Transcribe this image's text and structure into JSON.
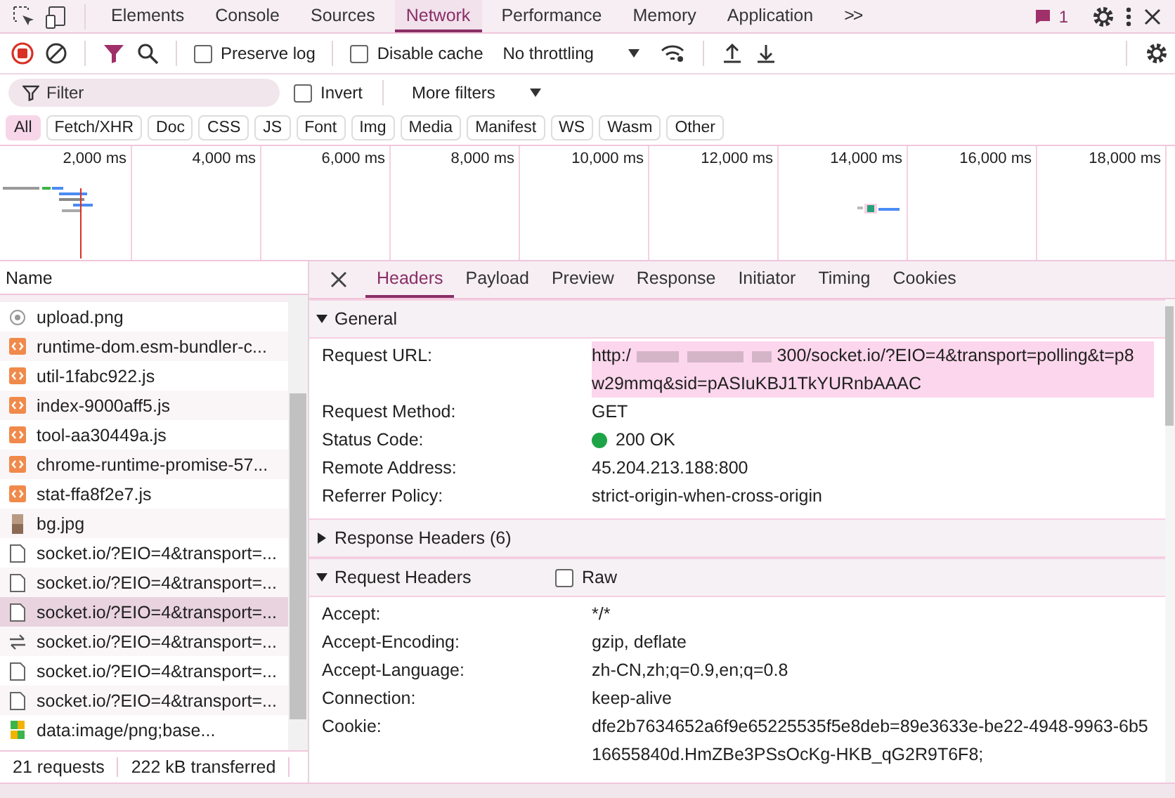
{
  "tabs": [
    {
      "label": "Elements",
      "selected": false
    },
    {
      "label": "Console",
      "selected": false
    },
    {
      "label": "Sources",
      "selected": false
    },
    {
      "label": "Network",
      "selected": true
    },
    {
      "label": "Performance",
      "selected": false
    },
    {
      "label": "Memory",
      "selected": false
    },
    {
      "label": "Application",
      "selected": false
    }
  ],
  "more_tabs": ">>",
  "issues_count": "1",
  "toolbar": {
    "preserve_log": {
      "label": "Preserve log",
      "checked": false
    },
    "disable_cache": {
      "label": "Disable cache",
      "checked": false
    },
    "throttling": "No throttling"
  },
  "filter": {
    "placeholder": "Filter",
    "invert": {
      "label": "Invert",
      "checked": false
    },
    "more_filters": "More filters"
  },
  "type_filters": [
    {
      "label": "All",
      "selected": true
    },
    {
      "label": "Fetch/XHR",
      "selected": false
    },
    {
      "label": "Doc",
      "selected": false
    },
    {
      "label": "CSS",
      "selected": false
    },
    {
      "label": "JS",
      "selected": false
    },
    {
      "label": "Font",
      "selected": false
    },
    {
      "label": "Img",
      "selected": false
    },
    {
      "label": "Media",
      "selected": false
    },
    {
      "label": "Manifest",
      "selected": false
    },
    {
      "label": "WS",
      "selected": false
    },
    {
      "label": "Wasm",
      "selected": false
    },
    {
      "label": "Other",
      "selected": false
    }
  ],
  "timeline_ticks": [
    "2,000 ms",
    "4,000 ms",
    "6,000 ms",
    "8,000 ms",
    "10,000 ms",
    "12,000 ms",
    "14,000 ms",
    "16,000 ms",
    "18,000 ms"
  ],
  "requests": {
    "column": "Name",
    "rows": [
      {
        "name": "upload.png",
        "kind": "image",
        "selected": false
      },
      {
        "name": "runtime-dom.esm-bundler-c...",
        "kind": "script",
        "selected": false
      },
      {
        "name": "util-1fabc922.js",
        "kind": "script",
        "selected": false
      },
      {
        "name": "index-9000aff5.js",
        "kind": "script",
        "selected": false
      },
      {
        "name": "tool-aa30449a.js",
        "kind": "script",
        "selected": false
      },
      {
        "name": "chrome-runtime-promise-57...",
        "kind": "script",
        "selected": false
      },
      {
        "name": "stat-ffa8f2e7.js",
        "kind": "script",
        "selected": false
      },
      {
        "name": "bg.jpg",
        "kind": "photo",
        "selected": false
      },
      {
        "name": "socket.io/?EIO=4&transport=...",
        "kind": "document",
        "selected": false
      },
      {
        "name": "socket.io/?EIO=4&transport=...",
        "kind": "document",
        "selected": false
      },
      {
        "name": "socket.io/?EIO=4&transport=...",
        "kind": "document",
        "selected": true
      },
      {
        "name": "socket.io/?EIO=4&transport=...",
        "kind": "websocket",
        "selected": false
      },
      {
        "name": "socket.io/?EIO=4&transport=...",
        "kind": "document",
        "selected": false
      },
      {
        "name": "socket.io/?EIO=4&transport=...",
        "kind": "document",
        "selected": false
      },
      {
        "name": "data:image/png;base...",
        "kind": "data",
        "selected": false
      }
    ],
    "summary": [
      "21 requests",
      "222 kB transferred"
    ]
  },
  "detail_tabs": [
    {
      "label": "Headers",
      "selected": true
    },
    {
      "label": "Payload",
      "selected": false
    },
    {
      "label": "Preview",
      "selected": false
    },
    {
      "label": "Response",
      "selected": false
    },
    {
      "label": "Initiator",
      "selected": false
    },
    {
      "label": "Timing",
      "selected": false
    },
    {
      "label": "Cookies",
      "selected": false
    }
  ],
  "general": {
    "title": "General",
    "expanded": true,
    "request_url_label": "Request URL:",
    "request_url_start": "http:/",
    "request_url_end": "300/socket.io/?EIO=4&transport=polling&t=p8w29mmq&sid=pASIuKBJ1TkYURnbAAAC",
    "rows": [
      {
        "key": "Request Method:",
        "value": "GET",
        "kind": "text"
      },
      {
        "key": "Status Code:",
        "value": "200 OK",
        "kind": "status",
        "color": "#1ea446"
      },
      {
        "key": "Remote Address:",
        "value": "45.204.213.188:800",
        "kind": "text"
      },
      {
        "key": "Referrer Policy:",
        "value": "strict-origin-when-cross-origin",
        "kind": "text"
      }
    ]
  },
  "response_headers": {
    "title": "Response Headers (6)",
    "expanded": false
  },
  "request_headers": {
    "title": "Request Headers",
    "expanded": true,
    "raw": {
      "label": "Raw",
      "checked": false
    },
    "rows": [
      {
        "key": "Accept:",
        "value": "*/*"
      },
      {
        "key": "Accept-Encoding:",
        "value": "gzip, deflate"
      },
      {
        "key": "Accept-Language:",
        "value": "zh-CN,zh;q=0.9,en;q=0.8"
      },
      {
        "key": "Connection:",
        "value": "keep-alive"
      },
      {
        "key": "Cookie:",
        "value": "dfe2b7634652a6f9e65225535f5e8deb=89e3633e-be22-4948-9963-6b516655840d.HmZBe3PSsOcKg-HKB_qG2R9T6F8;"
      }
    ]
  }
}
